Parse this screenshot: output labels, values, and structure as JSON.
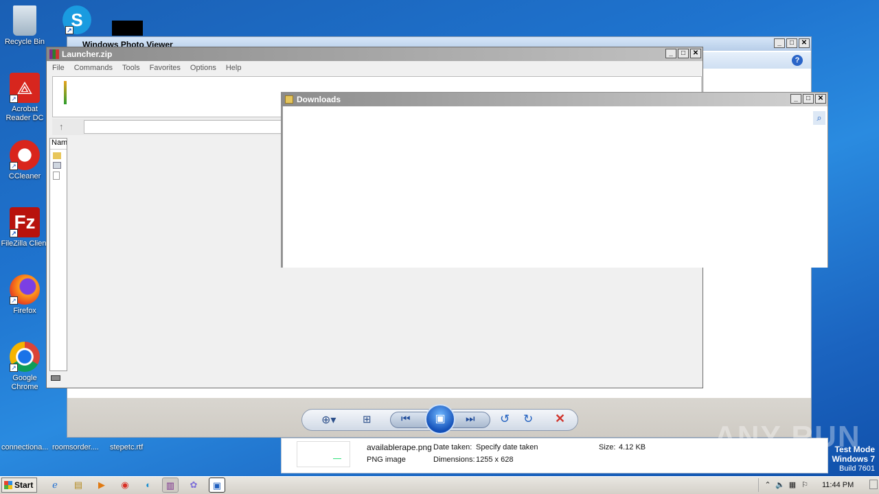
{
  "desktop": {
    "icons": [
      {
        "label": "Recycle Bin"
      },
      {
        "label": "Acrobat Reader DC"
      },
      {
        "label": "CCleaner"
      },
      {
        "label": "FileZilla Client"
      },
      {
        "label": "Firefox"
      },
      {
        "label": "Google Chrome"
      }
    ],
    "files": [
      {
        "label": "connectiona..."
      },
      {
        "label": "roomsorder...."
      },
      {
        "label": "stepetc.rtf"
      }
    ],
    "watermark": "ANY RUN",
    "test_mode": {
      "line1": "Test Mode",
      "line2": "Windows 7",
      "line3": "Build 7601"
    }
  },
  "photo_viewer": {
    "title": "Windows Photo Viewer",
    "image_text": "availablerape",
    "file_name": "availablerape.png",
    "file_type": "PNG image",
    "date_label": "Date taken:",
    "date_value": "Specify date taken",
    "dimensions_label": "Dimensions:",
    "dimensions_value": "1255 x 628",
    "size_label": "Size:",
    "size_value": "4.12 KB"
  },
  "winrar": {
    "title": "Launcher.zip",
    "menu": [
      "File",
      "Commands",
      "Tools",
      "Favorites",
      "Options",
      "Help"
    ],
    "column_name": "Nam"
  },
  "downloads": {
    "title": "Downloads"
  },
  "taskbar": {
    "start_label": "Start",
    "clock": "11:44 PM"
  },
  "colors": {
    "accent_green": "#2ee07a",
    "close_red": "#d0342c"
  }
}
